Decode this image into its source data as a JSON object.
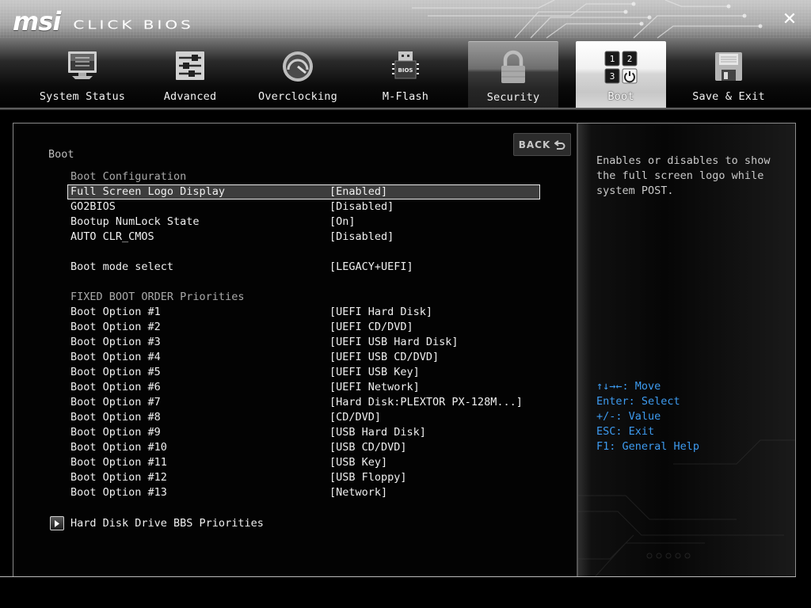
{
  "header": {
    "brand": "msi",
    "product": "CLICK BIOS",
    "close_icon": "close-icon"
  },
  "tabs": [
    {
      "label": "System Status",
      "icon": "monitor-icon"
    },
    {
      "label": "Advanced",
      "icon": "sliders-icon"
    },
    {
      "label": "Overclocking",
      "icon": "gauge-icon"
    },
    {
      "label": "M-Flash",
      "icon": "usb-bios-icon",
      "icon_text": "BIOS"
    },
    {
      "label": "Security",
      "icon": "padlock-icon"
    },
    {
      "label": "Boot",
      "icon": "boot-order-icon",
      "active": true,
      "icon_digits": [
        "1",
        "2",
        "3"
      ]
    },
    {
      "label": "Save & Exit",
      "icon": "floppy-disk-icon"
    }
  ],
  "main": {
    "title": "Boot",
    "back_label": "BACK",
    "section_boot_config": "Boot Configuration",
    "settings": [
      {
        "label": "Full Screen Logo Display",
        "value": "[Enabled]",
        "selected": true
      },
      {
        "label": "GO2BIOS",
        "value": "[Disabled]"
      },
      {
        "label": "Bootup NumLock State",
        "value": "[On]"
      },
      {
        "label": "AUTO CLR_CMOS",
        "value": "[Disabled]"
      }
    ],
    "boot_mode": {
      "label": "Boot mode select",
      "value": "[LEGACY+UEFI]"
    },
    "section_fixed_order": "FIXED BOOT ORDER Priorities",
    "boot_options": [
      {
        "label": "Boot Option #1",
        "value": "[UEFI Hard Disk]"
      },
      {
        "label": "Boot Option #2",
        "value": "[UEFI CD/DVD]"
      },
      {
        "label": "Boot Option #3",
        "value": "[UEFI USB Hard Disk]"
      },
      {
        "label": "Boot Option #4",
        "value": "[UEFI USB CD/DVD]"
      },
      {
        "label": "Boot Option #5",
        "value": "[UEFI USB Key]"
      },
      {
        "label": "Boot Option #6",
        "value": "[UEFI Network]"
      },
      {
        "label": "Boot Option #7",
        "value": "[Hard Disk:PLEXTOR PX-128M...]"
      },
      {
        "label": "Boot Option #8",
        "value": "[CD/DVD]"
      },
      {
        "label": "Boot Option #9",
        "value": "[USB Hard Disk]"
      },
      {
        "label": "Boot Option #10",
        "value": "[USB CD/DVD]"
      },
      {
        "label": "Boot Option #11",
        "value": "[USB Key]"
      },
      {
        "label": "Boot Option #12",
        "value": "[USB Floppy]"
      },
      {
        "label": "Boot Option #13",
        "value": "[Network]"
      }
    ],
    "submenu": "Hard Disk Drive BBS Priorities"
  },
  "help": {
    "description": "Enables or disables to show the full screen logo while system POST.",
    "hotkeys": [
      "↑↓→←: Move",
      "Enter: Select",
      "+/-: Value",
      "ESC: Exit",
      "F1: General Help"
    ]
  },
  "colors": {
    "hotkey_text": "#3d9bf0",
    "selection_bg": "#3d3d3d",
    "active_tab": "#ffffff"
  }
}
